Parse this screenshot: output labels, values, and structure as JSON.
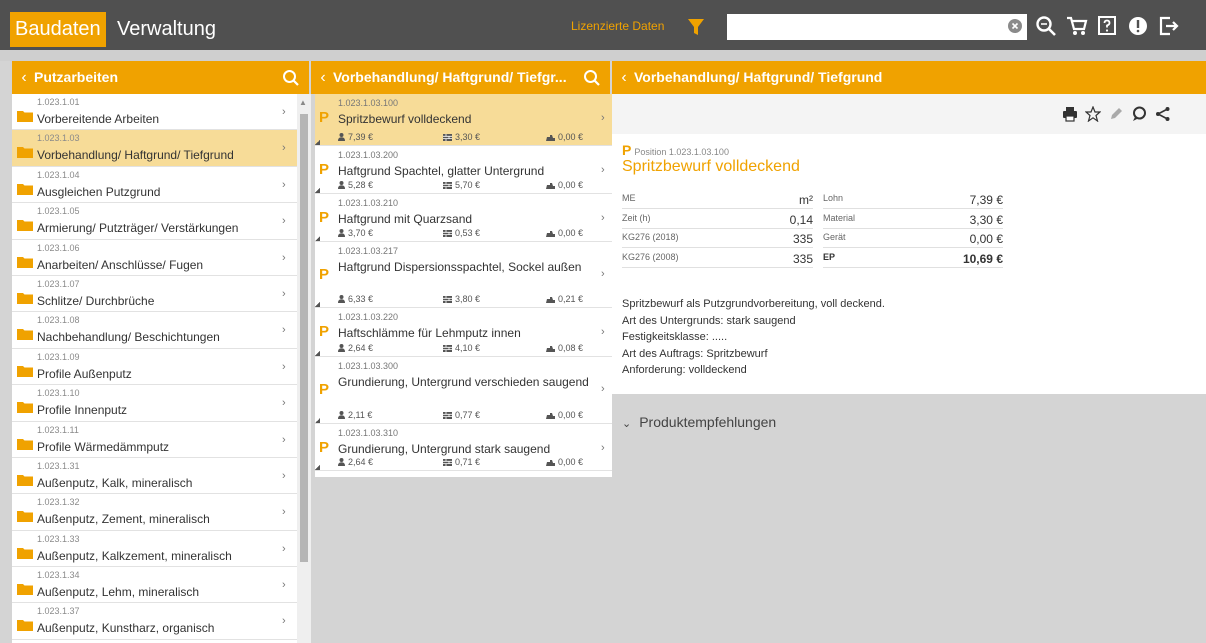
{
  "topbar": {
    "tab_active": "Baudaten",
    "tab_other": "Verwaltung",
    "licensed_label": "Lizenzierte Daten",
    "search_placeholder": "",
    "accent": "#f0a200"
  },
  "panels": {
    "left_title": "Putzarbeiten",
    "middle_title": "Vorbehandlung/ Haftgrund/ Tiefgr...",
    "right_title": "Vorbehandlung/ Haftgrund/ Tiefgrund"
  },
  "left_items": [
    {
      "num": "1.023.1.01",
      "label": "Vorbereitende Arbeiten"
    },
    {
      "num": "1.023.1.03",
      "label": "Vorbehandlung/ Haftgrund/ Tiefgrund"
    },
    {
      "num": "1.023.1.04",
      "label": "Ausgleichen Putzgrund"
    },
    {
      "num": "1.023.1.05",
      "label": "Armierung/ Putzträger/ Verstärkungen"
    },
    {
      "num": "1.023.1.06",
      "label": "Anarbeiten/ Anschlüsse/ Fugen"
    },
    {
      "num": "1.023.1.07",
      "label": "Schlitze/ Durchbrüche"
    },
    {
      "num": "1.023.1.08",
      "label": "Nachbehandlung/ Beschichtungen"
    },
    {
      "num": "1.023.1.09",
      "label": "Profile Außenputz"
    },
    {
      "num": "1.023.1.10",
      "label": "Profile Innenputz"
    },
    {
      "num": "1.023.1.11",
      "label": "Profile Wärmedämmputz"
    },
    {
      "num": "1.023.1.31",
      "label": "Außenputz, Kalk, mineralisch"
    },
    {
      "num": "1.023.1.32",
      "label": "Außenputz, Zement, mineralisch"
    },
    {
      "num": "1.023.1.33",
      "label": "Außenputz, Kalkzement, mineralisch"
    },
    {
      "num": "1.023.1.34",
      "label": "Außenputz, Lehm, mineralisch"
    },
    {
      "num": "1.023.1.37",
      "label": "Außenputz, Kunstharz, organisch"
    }
  ],
  "mid_items": [
    {
      "num": "1.023.1.03.100",
      "title": "Spritzbewurf volldeckend",
      "lohn": "7,39 €",
      "material": "3,30 €",
      "geraet": "0,00 €"
    },
    {
      "num": "1.023.1.03.200",
      "title": "Haftgrund Spachtel, glatter Untergrund",
      "lohn": "5,28 €",
      "material": "5,70 €",
      "geraet": "0,00 €"
    },
    {
      "num": "1.023.1.03.210",
      "title": "Haftgrund mit Quarzsand",
      "lohn": "3,70 €",
      "material": "0,53 €",
      "geraet": "0,00 €"
    },
    {
      "num": "1.023.1.03.217",
      "title": "Haftgrund Dispersionsspachtel, Sockel außen",
      "lohn": "6,33 €",
      "material": "3,80 €",
      "geraet": "0,21 €"
    },
    {
      "num": "1.023.1.03.220",
      "title": "Haftschlämme für Lehmputz innen",
      "lohn": "2,64 €",
      "material": "4,10 €",
      "geraet": "0,08 €"
    },
    {
      "num": "1.023.1.03.300",
      "title": "Grundierung, Untergrund verschieden saugend",
      "lohn": "2,11 €",
      "material": "0,77 €",
      "geraet": "0,00 €"
    },
    {
      "num": "1.023.1.03.310",
      "title": "Grundierung, Untergrund stark saugend",
      "lohn": "2,64 €",
      "material": "0,71 €",
      "geraet": "0,00 €"
    }
  ],
  "detail": {
    "p_letter": "P",
    "position_label": "Position",
    "position_num": "1.023.1.03.100",
    "title": "Spritzbewurf volldeckend",
    "left_table": [
      {
        "k": "ME",
        "v": "m²"
      },
      {
        "k": "Zeit (h)",
        "v": "0,14"
      },
      {
        "k": "KG276 (2018)",
        "v": "335"
      },
      {
        "k": "KG276 (2008)",
        "v": "335"
      }
    ],
    "right_table": [
      {
        "k": "Lohn",
        "v": "7,39 €"
      },
      {
        "k": "Material",
        "v": "3,30 €"
      },
      {
        "k": "Gerät",
        "v": "0,00 €"
      },
      {
        "k": "EP",
        "v": "10,69 €"
      }
    ],
    "description": [
      "Spritzbewurf als Putzgrundvorbereitung, voll deckend.",
      "Art des Untergrunds: stark saugend",
      "Festigkeitsklasse: .....",
      "Art des Auftrags: Spritzbewurf",
      "Anforderung: volldeckend"
    ]
  },
  "produkt": {
    "label": "Produktempfehlungen"
  }
}
